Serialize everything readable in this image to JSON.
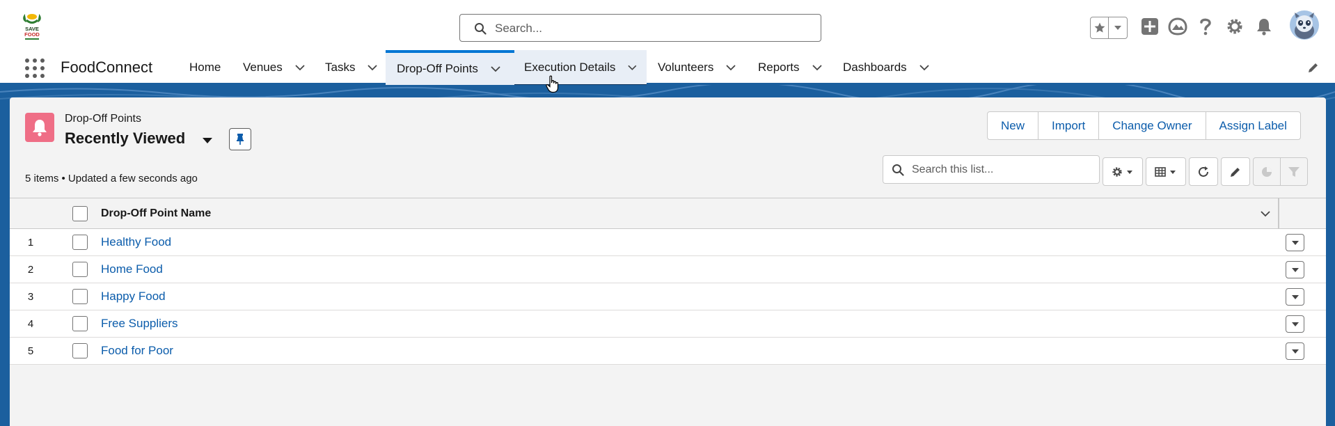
{
  "header": {
    "search_placeholder": "Search...",
    "logo_text": "SAVE FOOD",
    "icons": [
      "favorites-star-icon",
      "favorites-dropdown-icon",
      "global-actions-icon",
      "trailhead-icon",
      "help-icon",
      "setup-gear-icon",
      "notifications-bell-icon",
      "user-avatar"
    ]
  },
  "nav": {
    "app_name": "FoodConnect",
    "items": [
      {
        "label": "Home",
        "has_menu": false
      },
      {
        "label": "Venues",
        "has_menu": true
      },
      {
        "label": "Tasks",
        "has_menu": true
      },
      {
        "label": "Drop-Off Points",
        "has_menu": true,
        "state": "active"
      },
      {
        "label": "Execution Details",
        "has_menu": true,
        "state": "hovered"
      },
      {
        "label": "Volunteers",
        "has_menu": true
      },
      {
        "label": "Reports",
        "has_menu": true
      },
      {
        "label": "Dashboards",
        "has_menu": true
      }
    ]
  },
  "list_view": {
    "object_label": "Drop-Off Points",
    "title": "Recently Viewed",
    "meta": "5 items • Updated a few seconds ago",
    "actions": [
      "New",
      "Import",
      "Change Owner",
      "Assign Label"
    ],
    "search_placeholder": "Search this list...",
    "columns": [
      "Drop-Off Point Name"
    ],
    "rows": [
      {
        "num": "1",
        "name": "Healthy Food"
      },
      {
        "num": "2",
        "name": "Home Food"
      },
      {
        "num": "3",
        "name": "Happy Food"
      },
      {
        "num": "4",
        "name": "Free Suppliers"
      },
      {
        "num": "5",
        "name": "Food for Poor"
      }
    ]
  },
  "colors": {
    "brand_blue": "#0176d3",
    "link_blue": "#0b5cab",
    "banner_blue": "#1b5f9e",
    "object_icon_pink": "#ef6e86"
  }
}
